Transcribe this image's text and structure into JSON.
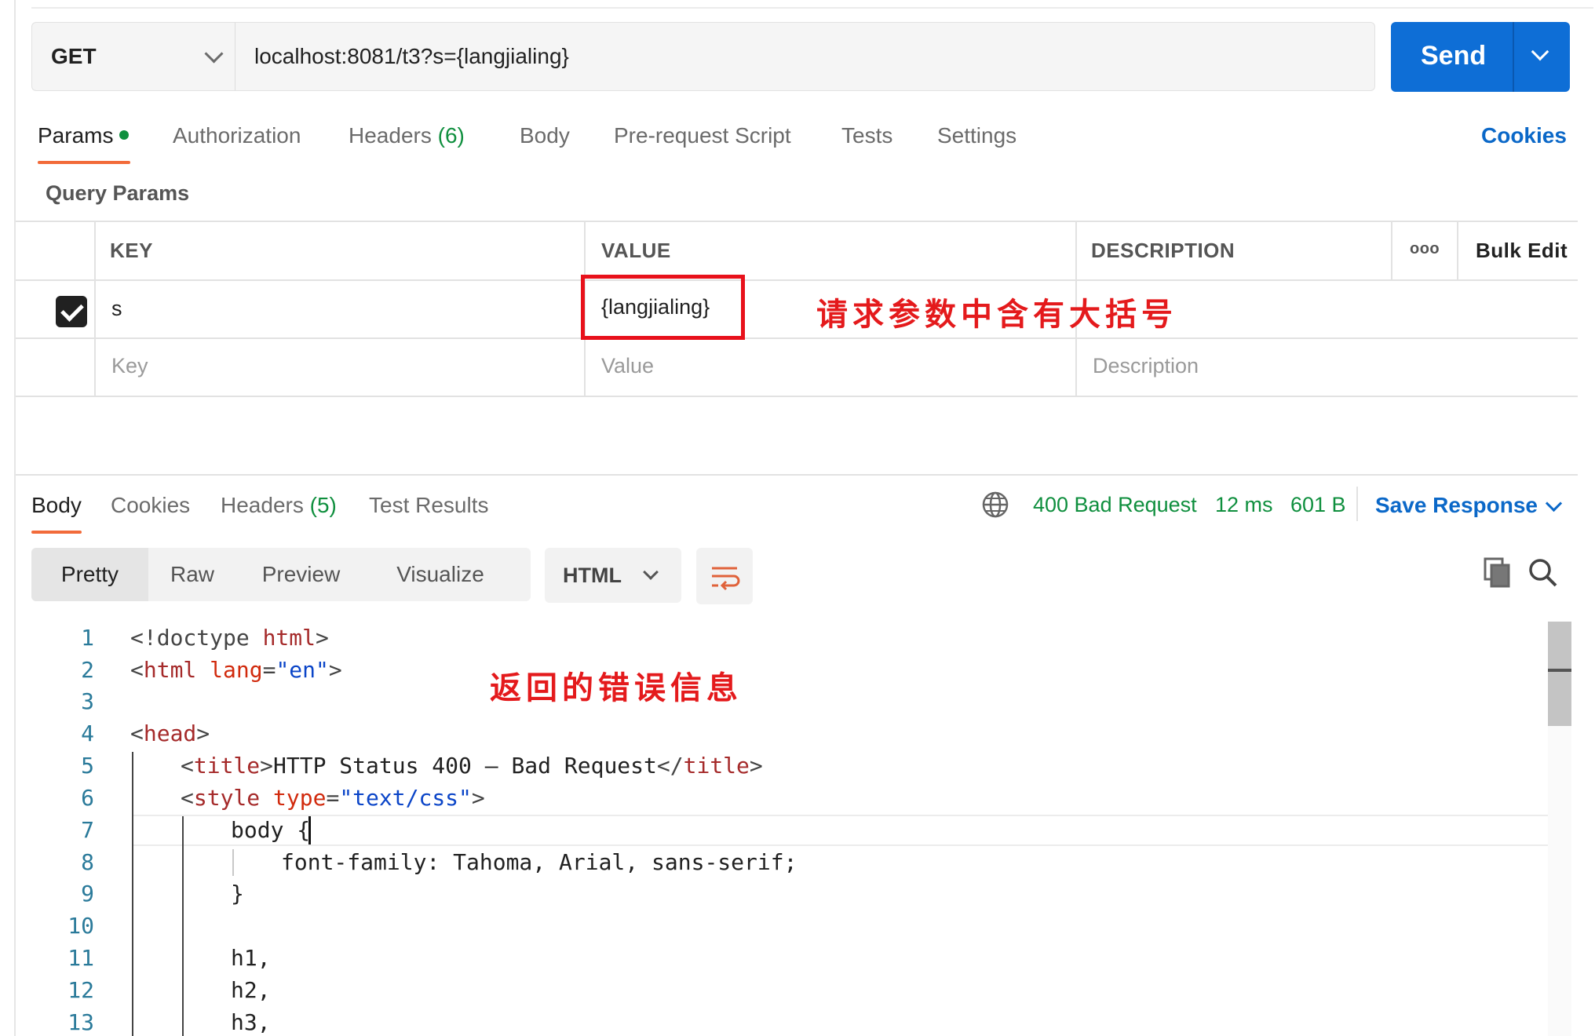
{
  "request": {
    "method": "GET",
    "url": "localhost:8081/t3?s={langjialing}",
    "send_label": "Send"
  },
  "request_tabs": {
    "params": "Params",
    "authorization": "Authorization",
    "headers": "Headers",
    "headers_count": "(6)",
    "body": "Body",
    "prerequest": "Pre-request Script",
    "tests": "Tests",
    "settings": "Settings",
    "cookies": "Cookies"
  },
  "query_params": {
    "title": "Query Params",
    "columns": {
      "key": "KEY",
      "value": "VALUE",
      "description": "DESCRIPTION",
      "more": "ooo",
      "bulk_edit": "Bulk Edit"
    },
    "rows": [
      {
        "checked": true,
        "key": "s",
        "value": "{langjialing}"
      }
    ],
    "placeholder": {
      "key": "Key",
      "value": "Value",
      "description": "Description"
    }
  },
  "annotations": {
    "params_note": "请求参数中含有大括号",
    "response_note": "返回的错误信息",
    "color": "#e41a1c"
  },
  "response": {
    "tabs": {
      "body": "Body",
      "cookies": "Cookies",
      "headers": "Headers",
      "headers_count": "(5)",
      "test_results": "Test Results"
    },
    "status": "400 Bad Request",
    "time": "12 ms",
    "size": "601 B",
    "save_label": "Save Response",
    "views": [
      "Pretty",
      "Raw",
      "Preview",
      "Visualize"
    ],
    "format": "HTML"
  },
  "code_lines": [
    "1",
    "2",
    "3",
    "4",
    "5",
    "6",
    "7",
    "8",
    "9",
    "10",
    "11",
    "12",
    "13"
  ],
  "colors": {
    "accent": "#0e6ed6",
    "tab_underline": "#f26b3a",
    "success_green": "#0f8f3e",
    "link_blue": "#0b68c8"
  }
}
